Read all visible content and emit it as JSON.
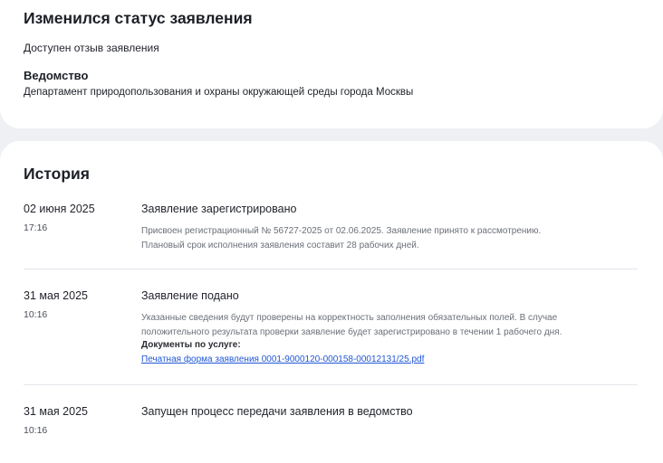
{
  "status": {
    "title": "Изменился статус заявления",
    "subtitle": "Доступен отзыв заявления",
    "department_label": "Ведомство",
    "department_value": "Департамент природопользования и охраны окружающей среды города Москвы"
  },
  "history": {
    "title": "История",
    "events": [
      {
        "date": "02 июня 2025",
        "time": "17:16",
        "title": "Заявление зарегистрировано",
        "description_lines": [
          "Присвоен регистрационный № 56727-2025 от 02.06.2025. Заявление принято к рассмотрению.",
          "Плановый срок исполнения заявления составит 28 рабочих дней."
        ]
      },
      {
        "date": "31 мая 2025",
        "time": "10:16",
        "title": "Заявление подано",
        "description_lines": [
          "Указанные сведения будут проверены на корректность заполнения обязательных полей. В случае",
          "положительного результата проверки заявление будет зарегистрировано в течении 1 рабочего дня."
        ],
        "documents_label": "Документы по услуге:",
        "document_link": "Печатная форма заявления 0001-9000120-000158-00012131/25.pdf"
      },
      {
        "date": "31 мая 2025",
        "time": "10:16",
        "title": "Запущен процесс передачи заявления в ведомство"
      }
    ]
  }
}
